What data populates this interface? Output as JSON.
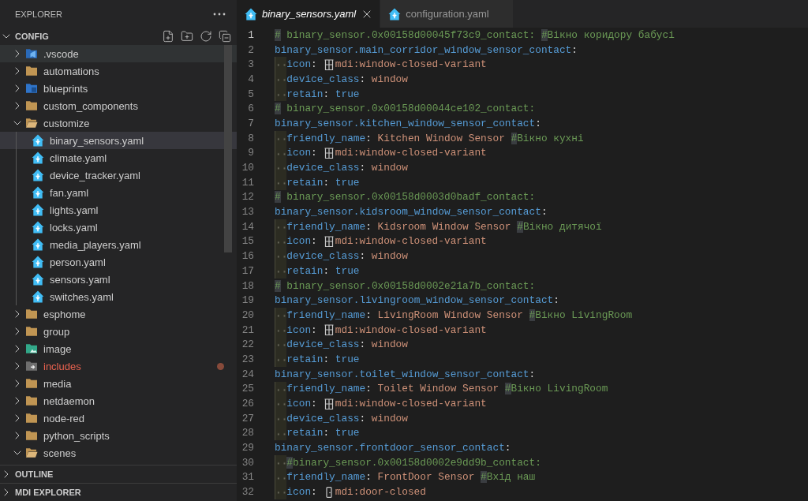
{
  "sidebar": {
    "title": "EXPLORER",
    "sections": [
      {
        "title": "CONFIG",
        "expanded": true,
        "tree": [
          {
            "label": ".vscode",
            "kind": "vscode",
            "expanded": false,
            "selected": false,
            "hovered": true,
            "problem": false
          },
          {
            "label": "automations",
            "kind": "folder",
            "expanded": false,
            "selected": false,
            "hovered": false,
            "problem": false
          },
          {
            "label": "blueprints",
            "kind": "blueprints",
            "expanded": false,
            "selected": false,
            "hovered": false,
            "problem": false
          },
          {
            "label": "custom_components",
            "kind": "folder",
            "expanded": false,
            "selected": false,
            "hovered": false,
            "problem": false
          },
          {
            "label": "customize",
            "kind": "folder",
            "expanded": true,
            "selected": false,
            "hovered": false,
            "problem": false,
            "children": [
              {
                "label": "binary_sensors.yaml",
                "kind": "file",
                "selected": true,
                "hovered": false,
                "problem": false
              },
              {
                "label": "climate.yaml",
                "kind": "file",
                "selected": false,
                "hovered": false,
                "problem": false
              },
              {
                "label": "device_tracker.yaml",
                "kind": "file",
                "selected": false,
                "hovered": false,
                "problem": false
              },
              {
                "label": "fan.yaml",
                "kind": "file",
                "selected": false,
                "hovered": false,
                "problem": false
              },
              {
                "label": "lights.yaml",
                "kind": "file",
                "selected": false,
                "hovered": false,
                "problem": false
              },
              {
                "label": "locks.yaml",
                "kind": "file",
                "selected": false,
                "hovered": false,
                "problem": false
              },
              {
                "label": "media_players.yaml",
                "kind": "file",
                "selected": false,
                "hovered": false,
                "problem": false
              },
              {
                "label": "person.yaml",
                "kind": "file",
                "selected": false,
                "hovered": false,
                "problem": false
              },
              {
                "label": "sensors.yaml",
                "kind": "file",
                "selected": false,
                "hovered": false,
                "problem": false
              },
              {
                "label": "switches.yaml",
                "kind": "file",
                "selected": false,
                "hovered": false,
                "problem": false
              }
            ]
          },
          {
            "label": "esphome",
            "kind": "folder",
            "expanded": false,
            "selected": false,
            "hovered": false,
            "problem": false
          },
          {
            "label": "group",
            "kind": "folder",
            "expanded": false,
            "selected": false,
            "hovered": false,
            "problem": false
          },
          {
            "label": "image",
            "kind": "images",
            "expanded": false,
            "selected": false,
            "hovered": false,
            "problem": false
          },
          {
            "label": "includes",
            "kind": "includes",
            "expanded": false,
            "selected": false,
            "hovered": false,
            "problem": true
          },
          {
            "label": "media",
            "kind": "folder",
            "expanded": false,
            "selected": false,
            "hovered": false,
            "problem": false
          },
          {
            "label": "netdaemon",
            "kind": "folder",
            "expanded": false,
            "selected": false,
            "hovered": false,
            "problem": false
          },
          {
            "label": "node-red",
            "kind": "folder",
            "expanded": false,
            "selected": false,
            "hovered": false,
            "problem": false
          },
          {
            "label": "python_scripts",
            "kind": "folder",
            "expanded": false,
            "selected": false,
            "hovered": false,
            "problem": false
          },
          {
            "label": "scenes",
            "kind": "folder",
            "expanded": true,
            "selected": false,
            "hovered": false,
            "problem": false
          }
        ]
      },
      {
        "title": "OUTLINE",
        "expanded": false
      },
      {
        "title": "MDI EXPLORER",
        "expanded": false
      }
    ]
  },
  "editor": {
    "tabs": [
      {
        "label": "binary_sensors.yaml",
        "selected": true,
        "preview": true
      },
      {
        "label": "configuration.yaml",
        "selected": false,
        "preview": false
      }
    ],
    "lines": [
      {
        "number": "1",
        "active": true,
        "indented": false,
        "tokens": [
          {
            "kind": "hash",
            "text": "#"
          },
          {
            "kind": "comment",
            "text": " binary_sensor.0x00158d00045f73c9_contact: "
          },
          {
            "kind": "hash",
            "text": "#"
          },
          {
            "kind": "comment",
            "text": "Вікно коридору бабусі"
          }
        ]
      },
      {
        "number": "2",
        "active": false,
        "indented": false,
        "tokens": [
          {
            "kind": "key",
            "text": "binary_sensor.main_corridor_window_sensor_contact"
          },
          {
            "kind": "punct",
            "text": ":"
          }
        ]
      },
      {
        "number": "3",
        "active": false,
        "indented": true,
        "tokens": [
          {
            "kind": "key",
            "text": "icon"
          },
          {
            "kind": "punct",
            "text": ":"
          },
          {
            "kind": "window-preview"
          },
          {
            "kind": "string",
            "text": "mdi:window-closed-variant"
          }
        ]
      },
      {
        "number": "4",
        "active": false,
        "indented": true,
        "tokens": [
          {
            "kind": "key",
            "text": "device_class"
          },
          {
            "kind": "punct",
            "text": ": "
          },
          {
            "kind": "string",
            "text": "window"
          }
        ]
      },
      {
        "number": "5",
        "active": false,
        "indented": true,
        "tokens": [
          {
            "kind": "key",
            "text": "retain"
          },
          {
            "kind": "punct",
            "text": ": "
          },
          {
            "kind": "bool",
            "text": "true"
          }
        ]
      },
      {
        "number": "6",
        "active": false,
        "indented": false,
        "tokens": [
          {
            "kind": "hash",
            "text": "#"
          },
          {
            "kind": "comment",
            "text": " binary_sensor.0x00158d00044ce102_contact:"
          }
        ]
      },
      {
        "number": "7",
        "active": false,
        "indented": false,
        "tokens": [
          {
            "kind": "key",
            "text": "binary_sensor.kitchen_window_sensor_contact"
          },
          {
            "kind": "punct",
            "text": ":"
          }
        ]
      },
      {
        "number": "8",
        "active": false,
        "indented": true,
        "tokens": [
          {
            "kind": "key",
            "text": "friendly_name"
          },
          {
            "kind": "punct",
            "text": ": "
          },
          {
            "kind": "string",
            "text": "Kitchen Window Sensor "
          },
          {
            "kind": "hash",
            "text": "#"
          },
          {
            "kind": "comment",
            "text": "Вікно кухні"
          }
        ]
      },
      {
        "number": "9",
        "active": false,
        "indented": true,
        "tokens": [
          {
            "kind": "key",
            "text": "icon"
          },
          {
            "kind": "punct",
            "text": ":"
          },
          {
            "kind": "window-preview"
          },
          {
            "kind": "string",
            "text": "mdi:window-closed-variant"
          }
        ]
      },
      {
        "number": "10",
        "active": false,
        "indented": true,
        "tokens": [
          {
            "kind": "key",
            "text": "device_class"
          },
          {
            "kind": "punct",
            "text": ": "
          },
          {
            "kind": "string",
            "text": "window"
          }
        ]
      },
      {
        "number": "11",
        "active": false,
        "indented": true,
        "tokens": [
          {
            "kind": "key",
            "text": "retain"
          },
          {
            "kind": "punct",
            "text": ": "
          },
          {
            "kind": "bool",
            "text": "true"
          }
        ]
      },
      {
        "number": "12",
        "active": false,
        "indented": false,
        "tokens": [
          {
            "kind": "hash",
            "text": "#"
          },
          {
            "kind": "comment",
            "text": " binary_sensor.0x00158d0003d0badf_contact:"
          }
        ]
      },
      {
        "number": "13",
        "active": false,
        "indented": false,
        "tokens": [
          {
            "kind": "key",
            "text": "binary_sensor.kidsroom_window_sensor_contact"
          },
          {
            "kind": "punct",
            "text": ":"
          }
        ]
      },
      {
        "number": "14",
        "active": false,
        "indented": true,
        "tokens": [
          {
            "kind": "key",
            "text": "friendly_name"
          },
          {
            "kind": "punct",
            "text": ": "
          },
          {
            "kind": "string",
            "text": "Kidsroom Window Sensor "
          },
          {
            "kind": "hash",
            "text": "#"
          },
          {
            "kind": "comment",
            "text": "Вікно дитячої"
          }
        ]
      },
      {
        "number": "15",
        "active": false,
        "indented": true,
        "tokens": [
          {
            "kind": "key",
            "text": "icon"
          },
          {
            "kind": "punct",
            "text": ":"
          },
          {
            "kind": "window-preview"
          },
          {
            "kind": "string",
            "text": "mdi:window-closed-variant"
          }
        ]
      },
      {
        "number": "16",
        "active": false,
        "indented": true,
        "tokens": [
          {
            "kind": "key",
            "text": "device_class"
          },
          {
            "kind": "punct",
            "text": ": "
          },
          {
            "kind": "string",
            "text": "window"
          }
        ]
      },
      {
        "number": "17",
        "active": false,
        "indented": true,
        "tokens": [
          {
            "kind": "key",
            "text": "retain"
          },
          {
            "kind": "punct",
            "text": ": "
          },
          {
            "kind": "bool",
            "text": "true"
          }
        ]
      },
      {
        "number": "18",
        "active": false,
        "indented": false,
        "tokens": [
          {
            "kind": "hash",
            "text": "#"
          },
          {
            "kind": "comment",
            "text": " binary_sensor.0x00158d0002e21a7b_contact:"
          }
        ]
      },
      {
        "number": "19",
        "active": false,
        "indented": false,
        "tokens": [
          {
            "kind": "key",
            "text": "binary_sensor.livingroom_window_sensor_contact"
          },
          {
            "kind": "punct",
            "text": ":"
          }
        ]
      },
      {
        "number": "20",
        "active": false,
        "indented": true,
        "tokens": [
          {
            "kind": "key",
            "text": "friendly_name"
          },
          {
            "kind": "punct",
            "text": ": "
          },
          {
            "kind": "string",
            "text": "LivingRoom Window Sensor "
          },
          {
            "kind": "hash",
            "text": "#"
          },
          {
            "kind": "comment",
            "text": "Вікно LivingRoom"
          }
        ]
      },
      {
        "number": "21",
        "active": false,
        "indented": true,
        "tokens": [
          {
            "kind": "key",
            "text": "icon"
          },
          {
            "kind": "punct",
            "text": ":"
          },
          {
            "kind": "window-preview"
          },
          {
            "kind": "string",
            "text": "mdi:window-closed-variant"
          }
        ]
      },
      {
        "number": "22",
        "active": false,
        "indented": true,
        "tokens": [
          {
            "kind": "key",
            "text": "device_class"
          },
          {
            "kind": "punct",
            "text": ": "
          },
          {
            "kind": "string",
            "text": "window"
          }
        ]
      },
      {
        "number": "23",
        "active": false,
        "indented": true,
        "tokens": [
          {
            "kind": "key",
            "text": "retain"
          },
          {
            "kind": "punct",
            "text": ": "
          },
          {
            "kind": "bool",
            "text": "true"
          }
        ]
      },
      {
        "number": "24",
        "active": false,
        "indented": false,
        "tokens": [
          {
            "kind": "key",
            "text": "binary_sensor.toilet_window_sensor_contact"
          },
          {
            "kind": "punct",
            "text": ":"
          }
        ]
      },
      {
        "number": "25",
        "active": false,
        "indented": true,
        "tokens": [
          {
            "kind": "key",
            "text": "friendly_name"
          },
          {
            "kind": "punct",
            "text": ": "
          },
          {
            "kind": "string",
            "text": "Toilet Window Sensor "
          },
          {
            "kind": "hash",
            "text": "#"
          },
          {
            "kind": "comment",
            "text": "Вікно LivingRoom"
          }
        ]
      },
      {
        "number": "26",
        "active": false,
        "indented": true,
        "tokens": [
          {
            "kind": "key",
            "text": "icon"
          },
          {
            "kind": "punct",
            "text": ":"
          },
          {
            "kind": "window-preview"
          },
          {
            "kind": "string",
            "text": "mdi:window-closed-variant"
          }
        ]
      },
      {
        "number": "27",
        "active": false,
        "indented": true,
        "tokens": [
          {
            "kind": "key",
            "text": "device_class"
          },
          {
            "kind": "punct",
            "text": ": "
          },
          {
            "kind": "string",
            "text": "window"
          }
        ]
      },
      {
        "number": "28",
        "active": false,
        "indented": true,
        "tokens": [
          {
            "kind": "key",
            "text": "retain"
          },
          {
            "kind": "punct",
            "text": ": "
          },
          {
            "kind": "bool",
            "text": "true"
          }
        ]
      },
      {
        "number": "29",
        "active": false,
        "indented": false,
        "tokens": [
          {
            "kind": "key",
            "text": "binary_sensor.frontdoor_sensor_contact"
          },
          {
            "kind": "punct",
            "text": ":"
          }
        ]
      },
      {
        "number": "30",
        "active": false,
        "indented": true,
        "tokens": [
          {
            "kind": "hash",
            "text": "#"
          },
          {
            "kind": "comment",
            "text": "binary_sensor.0x00158d0002e9dd9b_contact:"
          }
        ]
      },
      {
        "number": "31",
        "active": false,
        "indented": true,
        "tokens": [
          {
            "kind": "key",
            "text": "friendly_name"
          },
          {
            "kind": "punct",
            "text": ": "
          },
          {
            "kind": "string",
            "text": "FrontDoor Sensor "
          },
          {
            "kind": "hash",
            "text": "#"
          },
          {
            "kind": "comment",
            "text": "Вхід наш"
          }
        ]
      },
      {
        "number": "32",
        "active": false,
        "indented": true,
        "tokens": [
          {
            "kind": "key",
            "text": "icon"
          },
          {
            "kind": "punct",
            "text": ":"
          },
          {
            "kind": "door-preview"
          },
          {
            "kind": "string",
            "text": "mdi:door-closed"
          }
        ]
      }
    ]
  }
}
